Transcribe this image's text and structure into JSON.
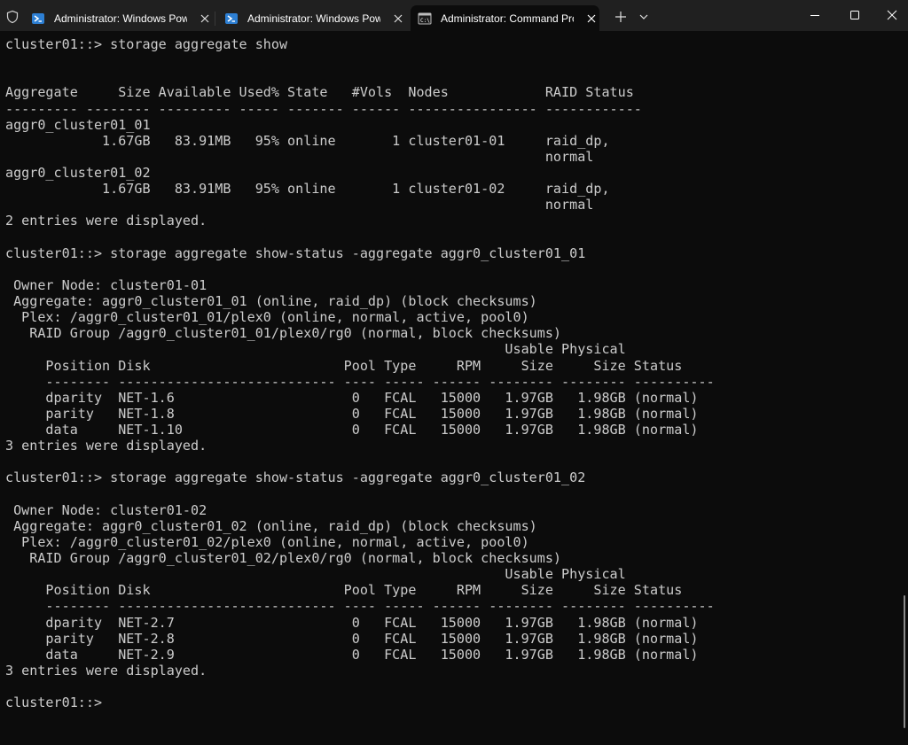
{
  "tabs": [
    {
      "title": "Administrator: Windows PowerShell",
      "icon": "powershell-icon",
      "active": false
    },
    {
      "title": "Administrator: Windows PowerShell",
      "icon": "powershell-icon",
      "active": false
    },
    {
      "title": "Administrator: Command Prompt",
      "icon": "command-prompt-icon",
      "active": true
    }
  ],
  "colors": {
    "titlebar": "#202020",
    "terminal_bg": "#0c0c0c",
    "terminal_fg": "#cccccc",
    "powershell_blue": "#2d7fd3"
  },
  "terminal": {
    "lines": [
      "cluster01::> storage aggregate show",
      "",
      "",
      "Aggregate     Size Available Used% State   #Vols  Nodes            RAID Status",
      "--------- -------- --------- ----- ------- ------ ---------------- ------------",
      "aggr0_cluster01_01",
      "            1.67GB   83.91MB   95% online       1 cluster01-01     raid_dp,",
      "                                                                   normal",
      "aggr0_cluster01_02",
      "            1.67GB   83.91MB   95% online       1 cluster01-02     raid_dp,",
      "                                                                   normal",
      "2 entries were displayed.",
      "",
      "cluster01::> storage aggregate show-status -aggregate aggr0_cluster01_01",
      "",
      " Owner Node: cluster01-01",
      " Aggregate: aggr0_cluster01_01 (online, raid_dp) (block checksums)",
      "  Plex: /aggr0_cluster01_01/plex0 (online, normal, active, pool0)",
      "   RAID Group /aggr0_cluster01_01/plex0/rg0 (normal, block checksums)",
      "                                                              Usable Physical",
      "     Position Disk                        Pool Type     RPM     Size     Size Status",
      "     -------- --------------------------- ---- ----- ------ -------- -------- ----------",
      "     dparity  NET-1.6                      0   FCAL   15000   1.97GB   1.98GB (normal)",
      "     parity   NET-1.8                      0   FCAL   15000   1.97GB   1.98GB (normal)",
      "     data     NET-1.10                     0   FCAL   15000   1.97GB   1.98GB (normal)",
      "3 entries were displayed.",
      "",
      "cluster01::> storage aggregate show-status -aggregate aggr0_cluster01_02",
      "",
      " Owner Node: cluster01-02",
      " Aggregate: aggr0_cluster01_02 (online, raid_dp) (block checksums)",
      "  Plex: /aggr0_cluster01_02/plex0 (online, normal, active, pool0)",
      "   RAID Group /aggr0_cluster01_02/plex0/rg0 (normal, block checksums)",
      "                                                              Usable Physical",
      "     Position Disk                        Pool Type     RPM     Size     Size Status",
      "     -------- --------------------------- ---- ----- ------ -------- -------- ----------",
      "     dparity  NET-2.7                      0   FCAL   15000   1.97GB   1.98GB (normal)",
      "     parity   NET-2.8                      0   FCAL   15000   1.97GB   1.98GB (normal)",
      "     data     NET-2.9                      0   FCAL   15000   1.97GB   1.98GB (normal)",
      "3 entries were displayed.",
      "",
      "cluster01::> "
    ]
  }
}
